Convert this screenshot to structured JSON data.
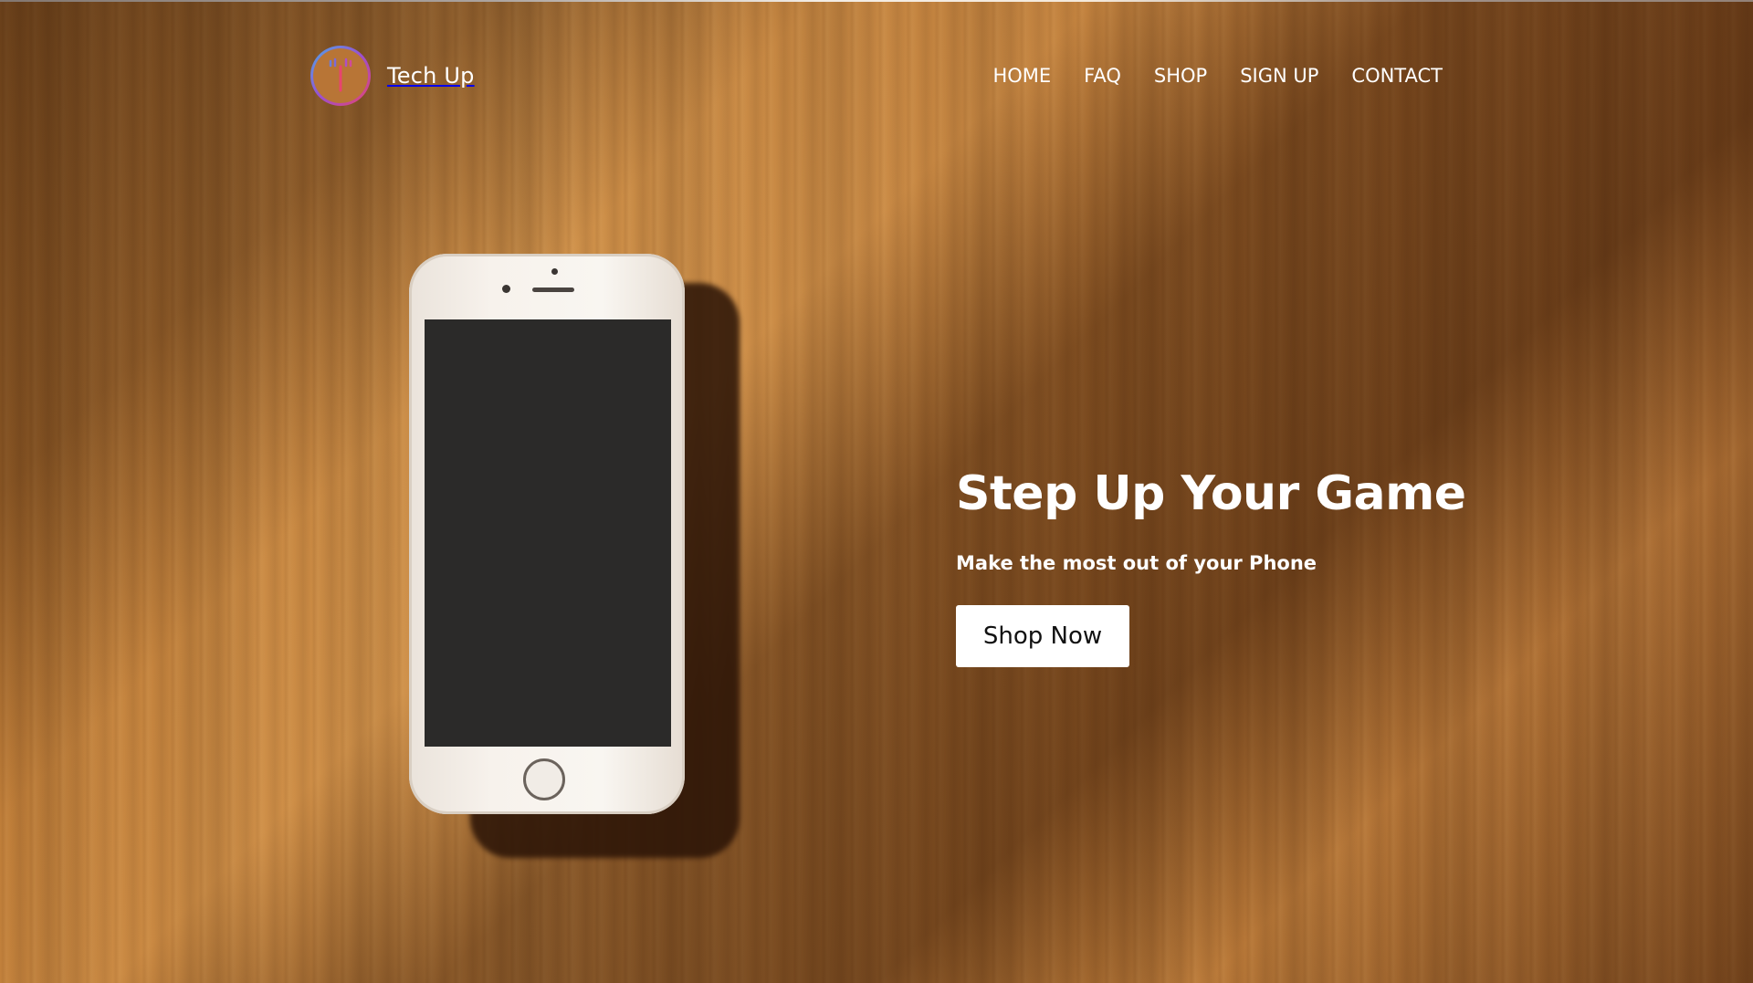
{
  "brand": {
    "name": "Tech Up",
    "logo_icon": "antenna-logo-icon",
    "logo_gradient": [
      "#4aa8e8",
      "#9b4fd0",
      "#e8446e"
    ]
  },
  "nav": {
    "items": [
      {
        "label": "HOME"
      },
      {
        "label": "FAQ"
      },
      {
        "label": "SHOP"
      },
      {
        "label": "SIGN UP"
      },
      {
        "label": "CONTACT"
      }
    ]
  },
  "hero": {
    "title": "Step Up Your Game",
    "subtitle": "Make the most out of your Phone",
    "cta_label": "Shop Now",
    "background": "wood-table-with-smartphone",
    "accent_text_color": "#ffffff",
    "cta_bg_color": "#ffffff"
  }
}
